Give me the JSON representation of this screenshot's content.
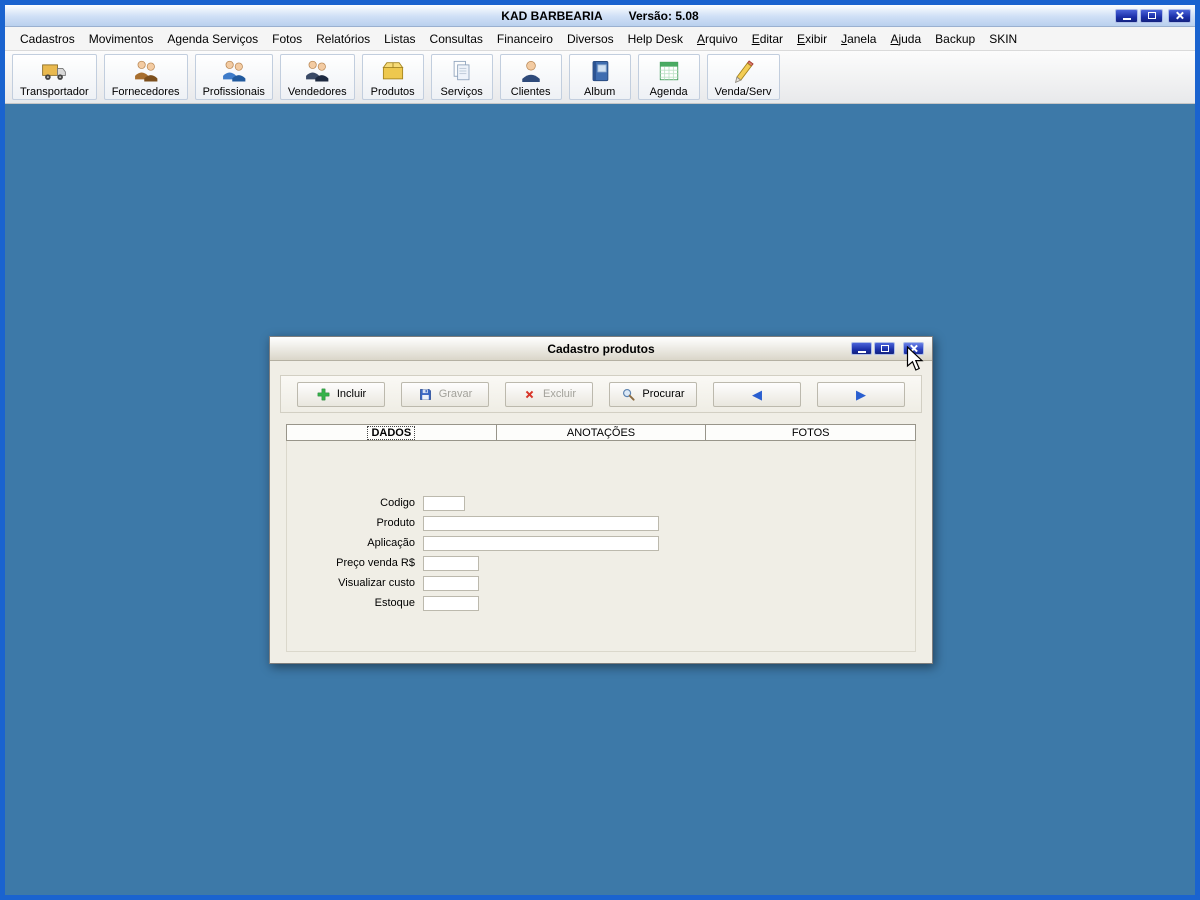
{
  "window": {
    "title": "KAD BARBEARIA",
    "version_label": "Versão: 5.08"
  },
  "menu": {
    "items": [
      "Cadastros",
      "Movimentos",
      "Agenda Serviços",
      "Fotos",
      "Relatórios",
      "Listas",
      "Consultas",
      "Financeiro",
      "Diversos",
      "Help Desk",
      "Arquivo",
      "Editar",
      "Exibir",
      "Janela",
      "Ajuda",
      "Backup",
      "SKIN"
    ]
  },
  "toolbar": {
    "buttons": [
      {
        "label": "Transportador",
        "icon": "truck-icon"
      },
      {
        "label": "Fornecedores",
        "icon": "suppliers-people-icon"
      },
      {
        "label": "Profissionais",
        "icon": "professionals-people-icon"
      },
      {
        "label": "Vendedores",
        "icon": "sellers-people-icon"
      },
      {
        "label": "Produtos",
        "icon": "box-icon"
      },
      {
        "label": "Serviços",
        "icon": "documents-icon"
      },
      {
        "label": "Clientes",
        "icon": "client-person-icon"
      },
      {
        "label": "Album",
        "icon": "album-book-icon"
      },
      {
        "label": "Agenda",
        "icon": "calendar-icon"
      },
      {
        "label": "Venda/Serv",
        "icon": "pencil-icon"
      }
    ]
  },
  "dialog": {
    "title": "Cadastro produtos",
    "toolbar": [
      {
        "label": "Incluir",
        "icon": "plus-icon",
        "enabled": true
      },
      {
        "label": "Gravar",
        "icon": "save-disk-icon",
        "enabled": false
      },
      {
        "label": "Excluir",
        "icon": "delete-x-icon",
        "enabled": false
      },
      {
        "label": "Procurar",
        "icon": "search-icon",
        "enabled": true
      }
    ],
    "nav": {
      "prev_icon": "◀",
      "next_icon": "▶"
    },
    "tabs": [
      {
        "label": "DADOS",
        "active": true
      },
      {
        "label": "ANOTAÇÕES",
        "active": false
      },
      {
        "label": "FOTOS",
        "active": false
      }
    ],
    "fields": [
      {
        "label": "Codigo",
        "value": ""
      },
      {
        "label": "Produto",
        "value": ""
      },
      {
        "label": "Aplicação",
        "value": ""
      },
      {
        "label": "Preço venda R$",
        "value": ""
      },
      {
        "label": "Visualizar custo",
        "value": ""
      },
      {
        "label": "Estoque",
        "value": ""
      }
    ]
  },
  "colors": {
    "frame_blue": "#1a63cf",
    "mdi_background": "#3d79a8",
    "titlebar_button_blue": "#1b2fa8"
  }
}
